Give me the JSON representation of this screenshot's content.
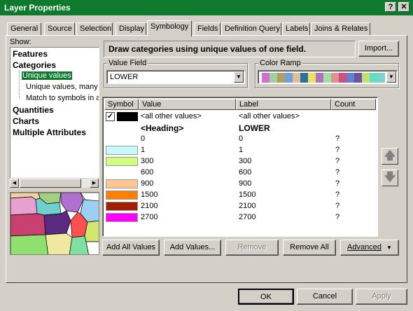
{
  "window": {
    "title": "Layer Properties",
    "help_btn": "?",
    "close_btn": "✕"
  },
  "tabs": [
    "General",
    "Source",
    "Selection",
    "Display",
    "Symbology",
    "Fields",
    "Definition Query",
    "Labels",
    "Joins & Relates"
  ],
  "active_tab": "Symbology",
  "show": {
    "label": "Show:",
    "tree": [
      {
        "label": "Features"
      },
      {
        "label": "Categories"
      },
      {
        "label": "Unique values"
      },
      {
        "label": "Unique values, many f"
      },
      {
        "label": "Match to symbols in a"
      },
      {
        "label": "Quantities"
      },
      {
        "label": "Charts"
      },
      {
        "label": "Multiple Attributes"
      }
    ]
  },
  "description": "Draw categories using unique values of one field.",
  "import_label": "Import...",
  "value_field": {
    "label": "Value Field",
    "value": "LOWER"
  },
  "color_ramp": {
    "label": "Color Ramp",
    "colors": [
      "#d070d0",
      "#a0d0a0",
      "#b0a060",
      "#70a0e0",
      "#e0c090",
      "#3070a0",
      "#f0e060",
      "#b070c0",
      "#a0e0a0",
      "#e09090",
      "#d05080",
      "#6080d0",
      "#7050a0",
      "#c0e070",
      "#60e0c0",
      "#80d0d0"
    ]
  },
  "table": {
    "headers": {
      "symbol": "Symbol",
      "value": "Value",
      "label": "Label",
      "count": "Count"
    },
    "other_row": {
      "value": "<all other values>",
      "label": "<all other values>",
      "color": "#000000"
    },
    "heading_row": {
      "value": "<Heading>",
      "label": "LOWER"
    },
    "rows": [
      {
        "color": "#ffffff",
        "value": "0",
        "label": "0",
        "count": "?"
      },
      {
        "color": "#c8f8f8",
        "value": "1",
        "label": "1",
        "count": "?"
      },
      {
        "color": "#d0ff80",
        "value": "300",
        "label": "300",
        "count": "?"
      },
      {
        "color": "#ffffff",
        "value": "600",
        "label": "600",
        "count": "?"
      },
      {
        "color": "#ffc890",
        "value": "900",
        "label": "900",
        "count": "?"
      },
      {
        "color": "#ff8000",
        "value": "1500",
        "label": "1500",
        "count": "?"
      },
      {
        "color": "#a02000",
        "value": "2100",
        "label": "2100",
        "count": "?"
      },
      {
        "color": "#ff00ff",
        "value": "2700",
        "label": "2700",
        "count": "?"
      }
    ]
  },
  "buttons": {
    "add_all": "Add All Values",
    "add_values": "Add Values...",
    "remove": "Remove",
    "remove_all": "Remove All",
    "advanced": "Advanced",
    "ok": "OK",
    "cancel": "Cancel",
    "apply": "Apply"
  }
}
